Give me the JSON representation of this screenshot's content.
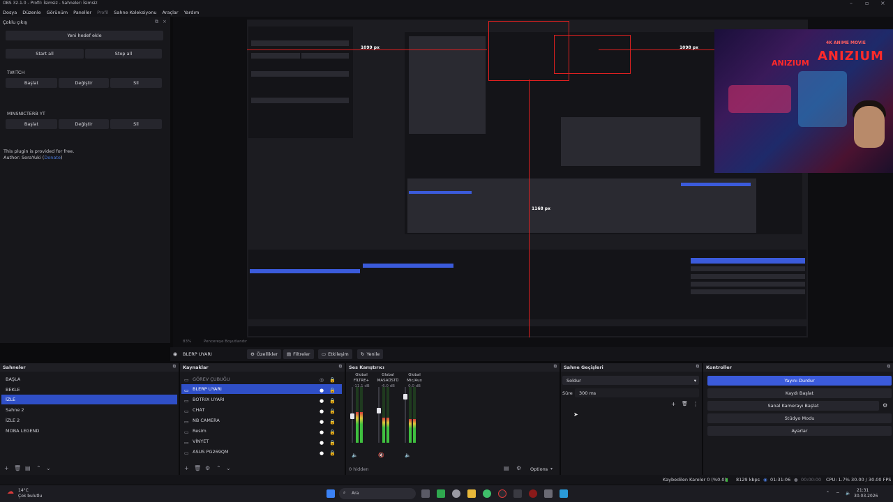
{
  "window": {
    "title": "OBS 32.1.0 - Profil: İsimsiz - Sahneler: İsimsiz"
  },
  "menu": [
    "Dosya",
    "Düzenle",
    "Görünüm",
    "Paneller",
    "Profil",
    "Sahne Koleksiyonu",
    "Araçlar",
    "Yardım"
  ],
  "multi_output": {
    "title": "Çoklu çıkış",
    "add_target": "Yeni hedef ekle",
    "start_all": "Start all",
    "stop_all": "Stop all",
    "targets": [
      {
        "name": "TWITCH",
        "start": "Başlat",
        "edit": "Değiştir",
        "delete": "Sil"
      },
      {
        "name": "MINSNICTERB YT",
        "start": "Başlat",
        "edit": "Değiştir",
        "delete": "Sil"
      }
    ],
    "note": "This plugin is provided for free.",
    "author_prefix": "Author: SoraYuki (",
    "author_link": "Donate",
    "author_suffix": ")"
  },
  "preview": {
    "measure_left": "1099 px",
    "measure_right": "1098 px",
    "measure_bottom": "1168 px",
    "logo_text": "ANIZIUM",
    "logo_text_small": "ANIZIUM",
    "logo_tag": "4K ANIME MOVIE"
  },
  "scale": {
    "zoom": "83%",
    "fit_label": "Pencereye Boyutlandır"
  },
  "toolbar": {
    "source_name": "BLERP UYARI",
    "properties": "Özellikler",
    "filters": "Filtreler",
    "interact": "Etkileşim",
    "refresh": "Yenile"
  },
  "scenes": {
    "title": "Sahneler",
    "items": [
      "BAŞLA",
      "BEKLE",
      "İZLE",
      "Sahne 2",
      "İZLE 2",
      "MOBA LEGEND"
    ],
    "selected": 2
  },
  "sources": {
    "title": "Kaynaklar",
    "items": [
      "GÖREV ÇUBUĞU",
      "BLERP UYARI",
      "BOTRIX UYARI",
      "CHAT",
      "NB CAMERA",
      "Resim",
      "VİNYET",
      "ASUS PG269QM"
    ],
    "selected": 1
  },
  "mixer": {
    "title": "Ses Karıştırıcı",
    "channels": [
      {
        "scope": "Global",
        "name": "FİLTRE+",
        "db": "-11.1 dB"
      },
      {
        "scope": "Global",
        "name": "MASAÜSTÜ",
        "db": "-6.0 dB"
      },
      {
        "scope": "Global",
        "name": "Mic/Aux",
        "db": "0.0 dB"
      }
    ],
    "levels": [
      0.55,
      0.45,
      0.42
    ],
    "hidden": "0 hidden",
    "options": "Options"
  },
  "transitions": {
    "title": "Sahne Geçişleri",
    "type": "Soldur",
    "duration_label": "Süre",
    "duration": "300 ms"
  },
  "controls": {
    "title": "Kontroller",
    "stop_stream": "Yayını Durdur",
    "start_record": "Kaydı Başlat",
    "start_vcam": "Sanal Kamerayı Başlat",
    "studio_mode": "Stüdyo Modu",
    "settings": "Ayarlar"
  },
  "status": {
    "dropped": "Kaybedilen Kareler 0 (%0.0)",
    "bitrate": "8129 kbps",
    "stream_time": "01:31:06",
    "rec_time": "00:00:00",
    "cpu": "CPU: 1.7%",
    "fps": "30.00 / 30.00 FPS"
  },
  "taskbar": {
    "weather_temp": "14°C",
    "weather_desc": "Çok bulutlu",
    "search": "Ara",
    "time": "21:31",
    "date": "30.03.2026"
  },
  "colors": {
    "accent": "#3b5bdb",
    "selected": "#2f4fc7",
    "panel": "#18181c",
    "measure": "#e02020"
  }
}
